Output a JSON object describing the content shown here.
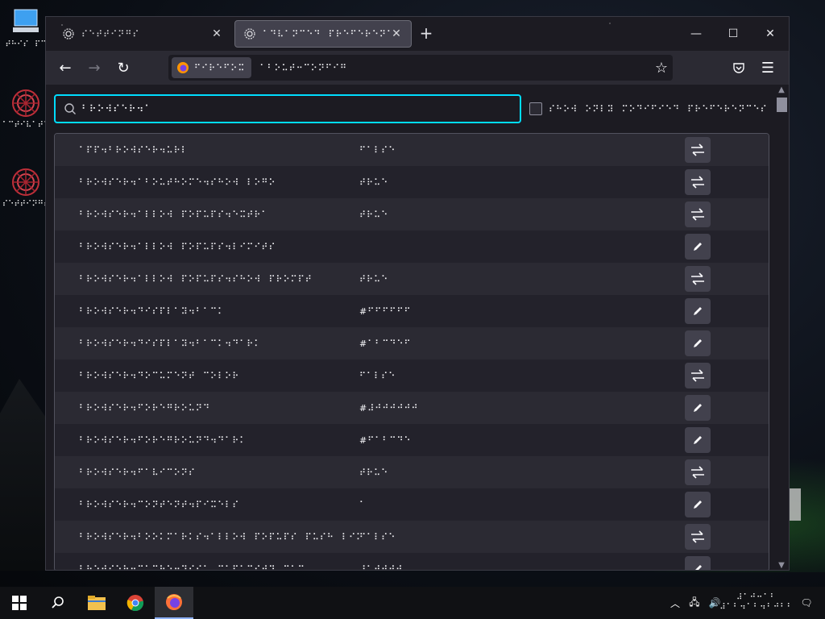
{
  "desktop": {
    "icons": [
      {
        "label": "⠞⠓⠊⠎⠀⠏⠉"
      },
      {
        "label": "⠁⠉⠞⠊⠧⠁⠞⠑"
      },
      {
        "label": "⠎⠑⠞⠞⠊⠝⠛⠎"
      }
    ]
  },
  "browser": {
    "tabs": [
      {
        "title": "⠎⠑⠞⠞⠊⠝⠛⠎",
        "active": false
      },
      {
        "title": "⠁⠙⠧⠁⠝⠉⠑⠙⠀⠏⠗⠑⠋⠑⠗⠑⠝⠉⠑⠎",
        "active": true
      }
    ],
    "new_tab_label": "+",
    "identity_label": "⠋⠊⠗⠑⠋⠕⠭",
    "url": "⠁⠃⠕⠥⠞⠒⠉⠕⠝⠋⠊⠛",
    "colors": {
      "accent": "#00ddff",
      "bg": "#1c1b22",
      "row_odd": "#2b2a33",
      "row_even": "#23222b"
    }
  },
  "config": {
    "search_value": "⠃⠗⠕⠺⠎⠑⠗⠲⠁",
    "show_modified_label": "⠎⠓⠕⠺⠀⠕⠝⠇⠽⠀⠍⠕⠙⠊⠋⠊⠑⠙⠀⠏⠗⠑⠋⠑⠗⠑⠝⠉⠑⠎",
    "rows": [
      {
        "name": "⠁⠏⠏⠲⠃⠗⠕⠺⠎⠑⠗⠲⠥⠗⠇",
        "value": "⠋⠁⠇⠎⠑",
        "action": "toggle-icon"
      },
      {
        "name": "⠃⠗⠕⠺⠎⠑⠗⠲⠁⠃⠕⠥⠞⠓⠕⠍⠑⠲⠎⠓⠕⠺⠀⠇⠕⠛⠕",
        "value": "⠞⠗⠥⠑",
        "action": "toggle-icon"
      },
      {
        "name": "⠃⠗⠕⠺⠎⠑⠗⠲⠁⠇⠇⠕⠺⠀⠏⠕⠏⠥⠏⠎⠲⠑⠭⠞⠗⠁",
        "value": "⠞⠗⠥⠑",
        "action": "toggle-icon"
      },
      {
        "name": "⠃⠗⠕⠺⠎⠑⠗⠲⠁⠇⠇⠕⠺⠀⠏⠕⠏⠥⠏⠎⠲⠇⠊⠍⠊⠞⠎",
        "value": "",
        "action": "edit-icon"
      },
      {
        "name": "⠃⠗⠕⠺⠎⠑⠗⠲⠁⠇⠇⠕⠺⠀⠏⠕⠏⠥⠏⠎⠲⠎⠓⠕⠺⠀⠏⠗⠕⠍⠏⠞",
        "value": "⠞⠗⠥⠑",
        "action": "toggle-icon"
      },
      {
        "name": "⠃⠗⠕⠺⠎⠑⠗⠲⠙⠊⠎⠏⠇⠁⠽⠲⠃⠁⠉⠅",
        "value": "#⠋⠋⠋⠋⠋⠋",
        "action": "edit-icon"
      },
      {
        "name": "⠃⠗⠕⠺⠎⠑⠗⠲⠙⠊⠎⠏⠇⠁⠽⠲⠃⠁⠉⠅⠲⠙⠁⠗⠅",
        "value": "#⠁⠃⠉⠙⠑⠋",
        "action": "edit-icon"
      },
      {
        "name": "⠃⠗⠕⠺⠎⠑⠗⠲⠙⠕⠉⠥⠍⠑⠝⠞⠀⠉⠕⠇⠕⠗",
        "value": "⠋⠁⠇⠎⠑",
        "action": "toggle-icon"
      },
      {
        "name": "⠃⠗⠕⠺⠎⠑⠗⠲⠋⠕⠗⠑⠛⠗⠕⠥⠝⠙",
        "value": "#⠼⠚⠚⠚⠚⠚⠚",
        "action": "edit-icon"
      },
      {
        "name": "⠃⠗⠕⠺⠎⠑⠗⠲⠋⠕⠗⠑⠛⠗⠕⠥⠝⠙⠲⠙⠁⠗⠅",
        "value": "#⠋⠁⠃⠉⠙⠑",
        "action": "edit-icon"
      },
      {
        "name": "⠃⠗⠕⠺⠎⠑⠗⠲⠋⠁⠧⠊⠉⠕⠝⠎",
        "value": "⠞⠗⠥⠑",
        "action": "toggle-icon"
      },
      {
        "name": "⠃⠗⠕⠺⠎⠑⠗⠲⠉⠕⠝⠞⠑⠝⠞⠲⠏⠊⠭⠑⠇⠎",
        "value": "⠁",
        "action": "edit-icon"
      },
      {
        "name": "⠃⠗⠕⠺⠎⠑⠗⠲⠃⠕⠕⠅⠍⠁⠗⠅⠎⠲⠁⠇⠇⠕⠺⠀⠏⠕⠏⠥⠏⠎⠀⠏⠥⠎⠓⠀⠇⠊⠝",
        "value": "⠋⠁⠇⠎⠑",
        "action": "toggle-icon"
      },
      {
        "name": "⠃⠗⠕⠺⠎⠑⠗⠲⠉⠁⠉⠓⠑⠲⠙⠊⠎⠅⠀⠉⠁⠏⠁⠉⠊⠞⠽⠀⠍⠁⠭",
        "value": "⠼⠁⠚⠚⠚⠚",
        "action": "edit-icon"
      }
    ]
  },
  "taskbar": {
    "clock_time": "⠼⠁⠚⠒⠁⠃",
    "clock_date": "⠼⠁⠃⠲⠁⠃⠲⠃⠚⠃⠃"
  }
}
